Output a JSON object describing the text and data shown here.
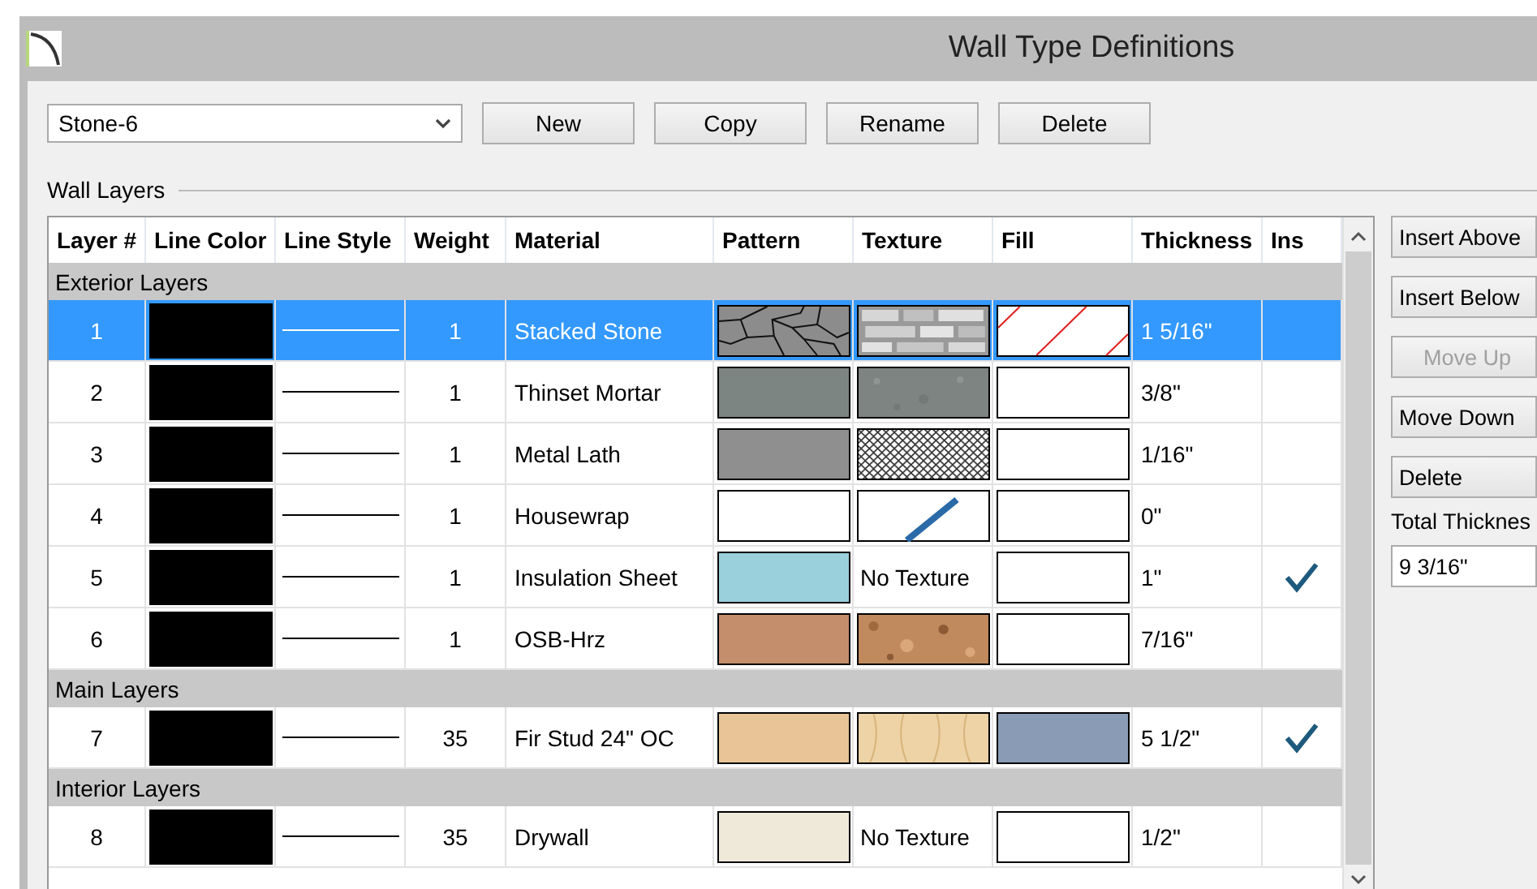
{
  "window": {
    "title": "Wall Type Definitions"
  },
  "wall_type": {
    "value": "Stone-6"
  },
  "buttons": [
    {
      "label": "New"
    },
    {
      "label": "Copy"
    },
    {
      "label": "Rename"
    },
    {
      "label": "Delete"
    }
  ],
  "group_label": "Wall Layers",
  "table": {
    "columns": [
      "Layer #",
      "Line Color",
      "Line Style",
      "Weight",
      "Material",
      "Pattern",
      "Texture",
      "Fill",
      "Thickness",
      "Ins"
    ],
    "sections": [
      {
        "title": "Exterior Layers",
        "rows": [
          {
            "layer": "1",
            "weight": "1",
            "material": "Stacked Stone",
            "pattern": {
              "kind": "stone",
              "color": "#8c8c8c"
            },
            "texture": {
              "kind": "stone"
            },
            "fill": {
              "kind": "hatch"
            },
            "thickness": "1 5/16\"",
            "ins": false,
            "selected": true
          },
          {
            "layer": "2",
            "weight": "1",
            "material": "Thinset Mortar",
            "pattern": {
              "kind": "solid",
              "color": "#7d8583"
            },
            "texture": {
              "kind": "concrete"
            },
            "fill": {
              "kind": "none"
            },
            "thickness": "3/8\"",
            "ins": false,
            "selected": false
          },
          {
            "layer": "3",
            "weight": "1",
            "material": "Metal Lath",
            "pattern": {
              "kind": "solid",
              "color": "#8f8f8f"
            },
            "texture": {
              "kind": "mesh"
            },
            "fill": {
              "kind": "none"
            },
            "thickness": "1/16\"",
            "ins": false,
            "selected": false
          },
          {
            "layer": "4",
            "weight": "1",
            "material": "Housewrap",
            "pattern": {
              "kind": "solid",
              "color": "#ffffff"
            },
            "texture": {
              "kind": "wrap"
            },
            "fill": {
              "kind": "none"
            },
            "thickness": "0\"",
            "ins": false,
            "selected": false
          },
          {
            "layer": "5",
            "weight": "1",
            "material": "Insulation  Sheet",
            "pattern": {
              "kind": "solid",
              "color": "#9acfdc"
            },
            "texture": {
              "kind": "none",
              "text": "No Texture"
            },
            "fill": {
              "kind": "none"
            },
            "thickness": "1\"",
            "ins": true,
            "selected": false
          },
          {
            "layer": "6",
            "weight": "1",
            "material": "OSB-Hrz",
            "pattern": {
              "kind": "solid",
              "color": "#c48e6c"
            },
            "texture": {
              "kind": "cork"
            },
            "fill": {
              "kind": "none"
            },
            "thickness": "7/16\"",
            "ins": false,
            "selected": false
          }
        ]
      },
      {
        "title": "Main Layers",
        "rows": [
          {
            "layer": "7",
            "weight": "35",
            "material": "Fir Stud 24\" OC",
            "pattern": {
              "kind": "solid",
              "color": "#e8c496"
            },
            "texture": {
              "kind": "wood"
            },
            "fill": {
              "kind": "solid",
              "color": "#8a9bb6"
            },
            "thickness": "5 1/2\"",
            "ins": true,
            "selected": false
          }
        ]
      },
      {
        "title": "Interior Layers",
        "rows": [
          {
            "layer": "8",
            "weight": "35",
            "material": "Drywall",
            "pattern": {
              "kind": "solid",
              "color": "#efe9da"
            },
            "texture": {
              "kind": "none",
              "text": "No Texture"
            },
            "fill": {
              "kind": "none"
            },
            "thickness": "1/2\"",
            "ins": false,
            "selected": false
          }
        ]
      }
    ]
  },
  "side_buttons": [
    {
      "label": "Insert Above",
      "disabled": false
    },
    {
      "label": "Insert Below",
      "disabled": false
    },
    {
      "label": "Move Up",
      "disabled": true
    },
    {
      "label": "Move Down",
      "disabled": false
    },
    {
      "label": "Delete",
      "disabled": false
    }
  ],
  "total_thickness": {
    "label": "Total Thicknes",
    "value": "9 3/16\""
  }
}
